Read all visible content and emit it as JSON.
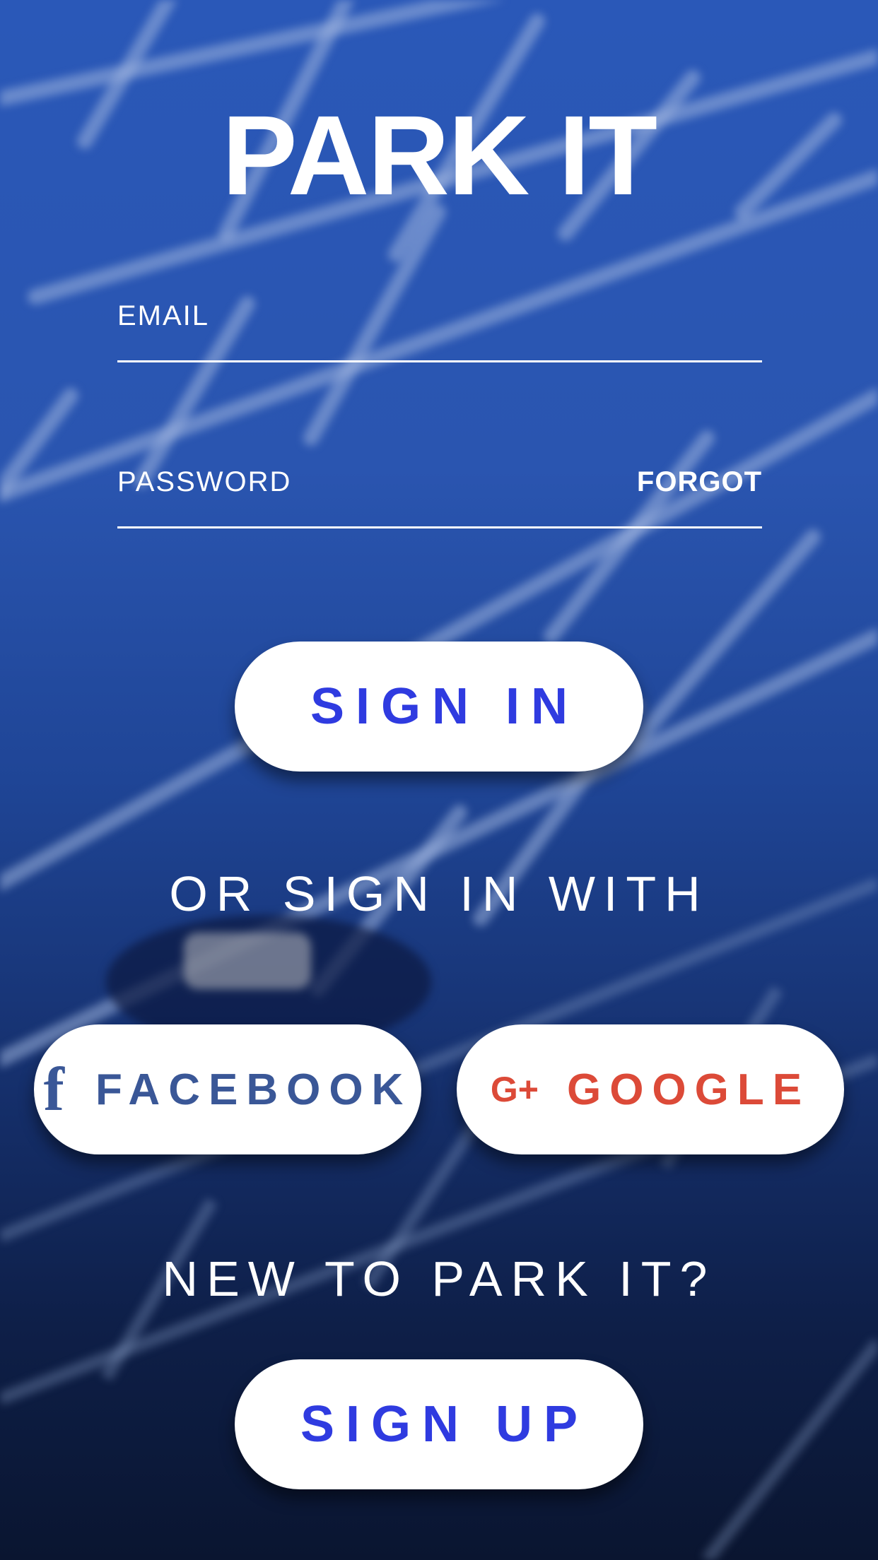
{
  "app": {
    "title": "PARK IT"
  },
  "form": {
    "email_label": "EMAIL",
    "password_label": "PASSWORD",
    "forgot_label": "FORGOT"
  },
  "actions": {
    "sign_in_label": "SIGN IN",
    "or_sign_in_with": "OR SIGN IN WITH",
    "facebook_label": "FACEBOOK",
    "google_label": "GOOGLE",
    "new_to_app": "NEW TO PARK IT?",
    "sign_up_label": "SIGN UP"
  },
  "icons": {
    "facebook": "facebook-icon",
    "google": "google-plus-icon"
  },
  "colors": {
    "primary_button_text": "#2f3be0",
    "facebook": "#3a5797",
    "google": "#dc4a38",
    "background_top": "#2a58b8",
    "background_bottom": "#0a1530"
  }
}
